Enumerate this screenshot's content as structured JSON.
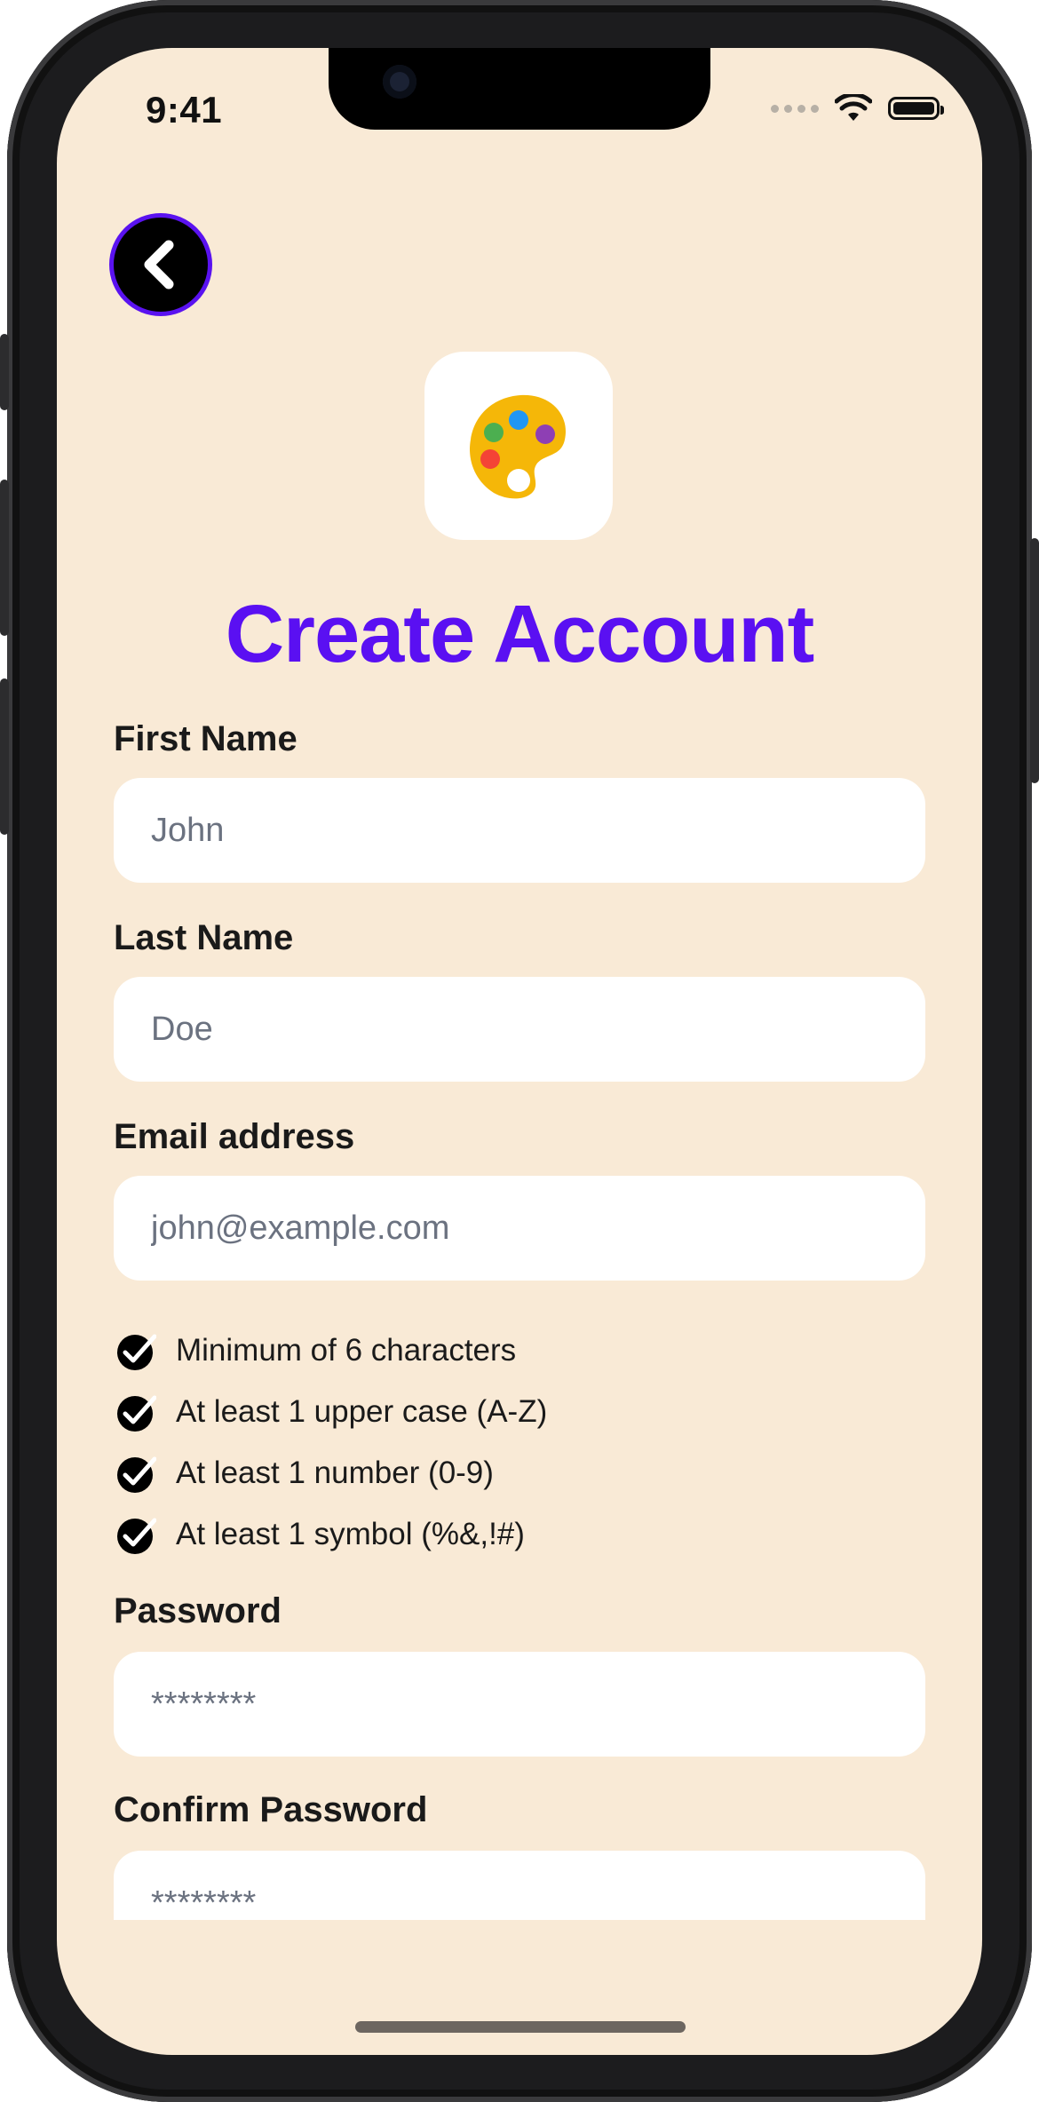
{
  "status_bar": {
    "time": "9:41"
  },
  "header": {
    "back_icon": "chevron-left-icon"
  },
  "app_icon": {
    "icon": "palette-icon"
  },
  "title": "Create Account",
  "fields": {
    "first_name": {
      "label": "First Name",
      "placeholder": "John"
    },
    "last_name": {
      "label": "Last Name",
      "placeholder": "Doe"
    },
    "email": {
      "label": "Email address",
      "placeholder": "john@example.com"
    },
    "password": {
      "label": "Password",
      "placeholder": "********"
    },
    "confirm_password": {
      "label": "Confirm Password",
      "placeholder": "********"
    }
  },
  "password_rules": [
    {
      "text": "Minimum of 6 characters",
      "checked": true
    },
    {
      "text": "At least 1 upper case (A-Z)",
      "checked": true
    },
    {
      "text": "At least 1 number (0-9)",
      "checked": true
    },
    {
      "text": "At least 1 symbol (%&,!#)",
      "checked": true
    }
  ],
  "colors": {
    "accent": "#5a10f2",
    "background": "#f9ead6",
    "field_bg": "#ffffff"
  }
}
